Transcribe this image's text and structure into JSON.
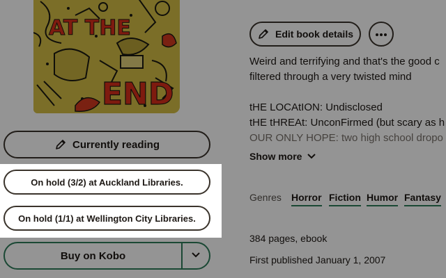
{
  "cover": {
    "title_line1": "AT THE",
    "title_line2": "END"
  },
  "actions": {
    "currently_reading": "Currently reading",
    "hold_auckland": "On hold (3/2) at Auckland Libraries.",
    "hold_wellington": "On hold (1/1) at Wellington City Libraries.",
    "buy": "Buy on Kobo",
    "edit": "Edit book details"
  },
  "description": {
    "lines": [
      "Weird and terrifying and that's the good c",
      "filtered through a very twisted mind",
      "",
      "tHE LOCAtION: Undisclosed",
      "tHE tHREAt: UnconFirmed (but scary as h",
      "OUR ONLY HOPE: two high school dropo"
    ],
    "show_more": "Show more"
  },
  "genres": {
    "label": "Genres",
    "items": [
      "Horror",
      "Fiction",
      "Humor",
      "Fantasy"
    ]
  },
  "details": {
    "pages": "384 pages, ebook",
    "published": "First published January 1, 2007"
  },
  "colors": {
    "accent": "#2e7d5b",
    "text": "#1e1915",
    "overlay": "rgba(0,0,0,0.42)"
  },
  "icons": {
    "reading": "pencil-icon",
    "edit": "pencil-icon",
    "more": "more-dots-icon",
    "show_more": "chevron-down-icon",
    "buy_menu": "chevron-down-icon"
  }
}
